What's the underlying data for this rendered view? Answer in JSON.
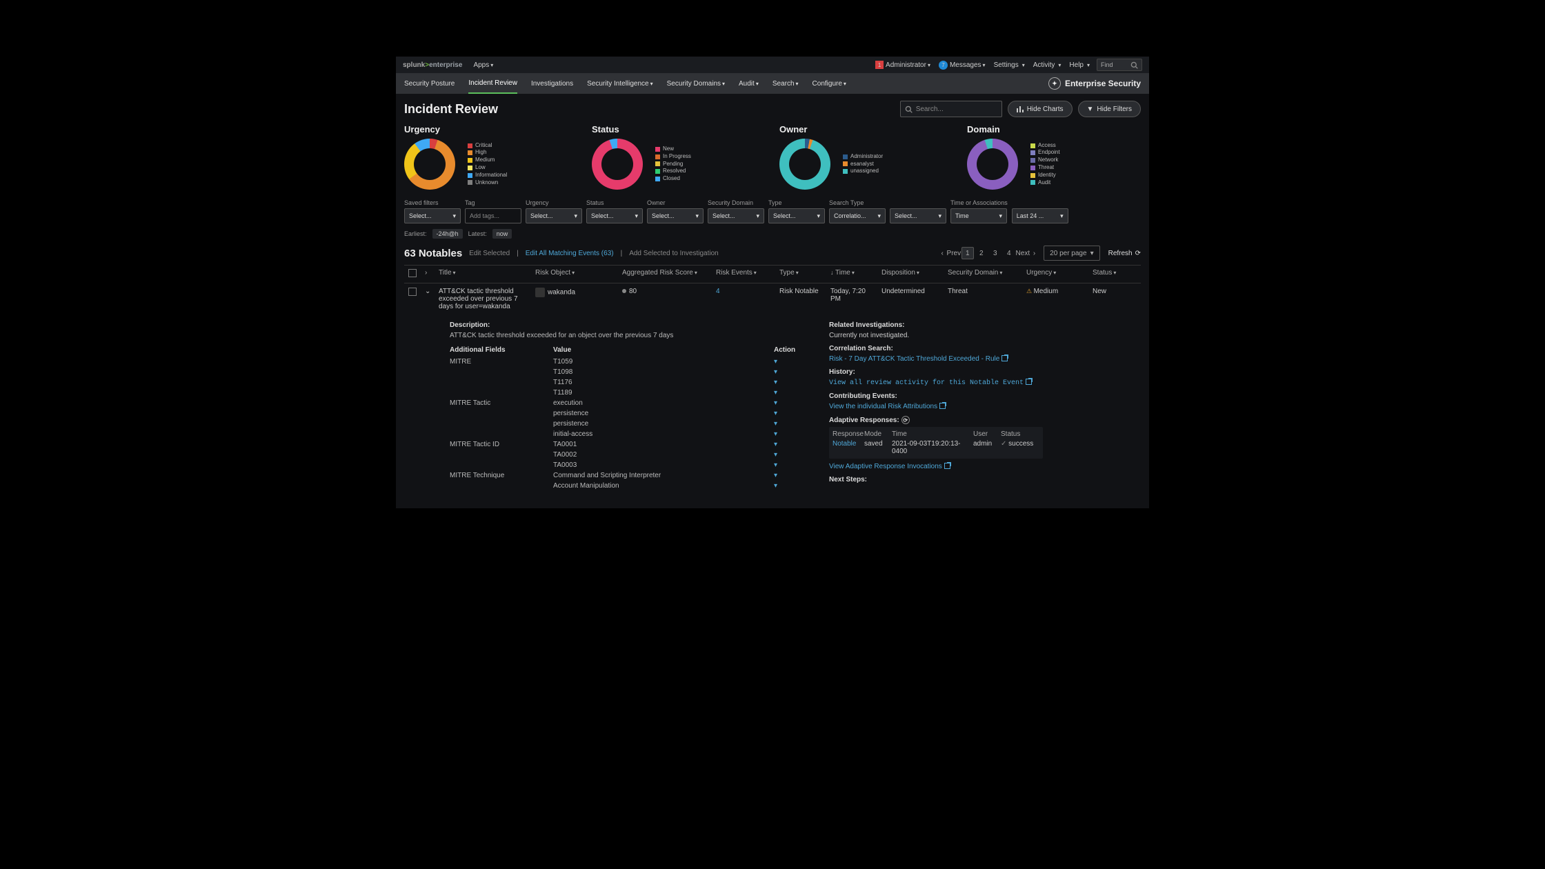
{
  "topbar": {
    "brand_pre": "splunk",
    "brand_gt": ">",
    "brand_suf": "enterprise",
    "apps": "Apps",
    "admin_badge": "1",
    "administrator": "Administrator",
    "msg_badge": "7",
    "messages": "Messages",
    "settings": "Settings",
    "activity": "Activity",
    "help": "Help",
    "find": "Find"
  },
  "nav": {
    "items": [
      "Security Posture",
      "Incident Review",
      "Investigations",
      "Security Intelligence",
      "Security Domains",
      "Audit",
      "Search",
      "Configure"
    ],
    "active": 1,
    "app_title": "Enterprise Security"
  },
  "page": {
    "title": "Incident Review",
    "search_ph": "Search...",
    "hide_charts": "Hide Charts",
    "hide_filters": "Hide Filters"
  },
  "chart_data": [
    {
      "name": "urgency",
      "title": "Urgency",
      "type": "pie",
      "series": [
        {
          "name": "Critical",
          "color": "#d93f3f",
          "value": 5
        },
        {
          "name": "High",
          "color": "#e88b2d",
          "value": 60
        },
        {
          "name": "Medium",
          "color": "#f0c419",
          "value": 25
        },
        {
          "name": "Low",
          "color": "#f5e663",
          "value": 0
        },
        {
          "name": "Informational",
          "color": "#3fa9f5",
          "value": 10
        },
        {
          "name": "Unknown",
          "color": "#7f7f7f",
          "value": 0
        }
      ]
    },
    {
      "name": "status",
      "title": "Status",
      "type": "pie",
      "series": [
        {
          "name": "New",
          "color": "#e63b6b",
          "value": 95
        },
        {
          "name": "In Progress",
          "color": "#d96b2b",
          "value": 0
        },
        {
          "name": "Pending",
          "color": "#e6c23b",
          "value": 0
        },
        {
          "name": "Resolved",
          "color": "#2ecc71",
          "value": 0
        },
        {
          "name": "Closed",
          "color": "#3fa9f5",
          "value": 5
        }
      ]
    },
    {
      "name": "owner",
      "title": "Owner",
      "type": "pie",
      "series": [
        {
          "name": "Administrator",
          "color": "#2b5b8c",
          "value": 3
        },
        {
          "name": "esanalyst",
          "color": "#e88b2d",
          "value": 2
        },
        {
          "name": "unassigned",
          "color": "#3fbfbf",
          "value": 95
        }
      ]
    },
    {
      "name": "domain",
      "title": "Domain",
      "type": "pie",
      "series": [
        {
          "name": "Access",
          "color": "#c9d94a",
          "value": 0
        },
        {
          "name": "Endpoint",
          "color": "#7f7fbf",
          "value": 0
        },
        {
          "name": "Network",
          "color": "#6a6aa6",
          "value": 0
        },
        {
          "name": "Threat",
          "color": "#8a5fbf",
          "value": 95
        },
        {
          "name": "Identity",
          "color": "#e6c23b",
          "value": 0
        },
        {
          "name": "Audit",
          "color": "#3fbfbf",
          "value": 5
        }
      ]
    }
  ],
  "filters": {
    "labels": [
      "Saved filters",
      "Tag",
      "Urgency",
      "Status",
      "Owner",
      "Security Domain",
      "Type",
      "Search Type",
      "",
      "Time or Associations",
      ""
    ],
    "values": [
      "Select...",
      "Add tags...",
      "Select...",
      "Select...",
      "Select...",
      "Select...",
      "Select...",
      "Correlatio...",
      "Select...",
      "Time",
      "Last 24 ..."
    ]
  },
  "time": {
    "earliest_lbl": "Earliest:",
    "earliest": "-24h@h",
    "latest_lbl": "Latest:",
    "latest": "now"
  },
  "list": {
    "count": "63 Notables",
    "edit_selected": "Edit Selected",
    "edit_all": "Edit All Matching Events (63)",
    "add_inv": "Add Selected to Investigation",
    "prev": "Prev",
    "next": "Next",
    "pages": [
      "1",
      "2",
      "3",
      "4"
    ],
    "per_page": "20 per page",
    "refresh": "Refresh"
  },
  "cols": {
    "title": "Title",
    "risk_obj": "Risk Object",
    "score": "Aggregated Risk Score",
    "events": "Risk Events",
    "type": "Type",
    "time": "Time",
    "disp": "Disposition",
    "dom": "Security Domain",
    "urg": "Urgency",
    "status": "Status"
  },
  "row": {
    "title": "ATT&CK tactic threshold exceeded over previous 7 days for user=wakanda",
    "risk_obj": "wakanda",
    "score": "80",
    "events": "4",
    "type": "Risk Notable",
    "time": "Today, 7:20 PM",
    "disp": "Undetermined",
    "dom": "Threat",
    "urg": "Medium",
    "status": "New"
  },
  "details": {
    "desc_h": "Description:",
    "desc": "ATT&CK tactic threshold exceeded for an object over the previous 7 days",
    "af_h": "Additional Fields",
    "val_h": "Value",
    "act_h": "Action",
    "fields": [
      {
        "l": "MITRE",
        "v": "T1059"
      },
      {
        "l": "",
        "v": "T1098"
      },
      {
        "l": "",
        "v": "T1176"
      },
      {
        "l": "",
        "v": "T1189"
      },
      {
        "l": "MITRE Tactic",
        "v": "execution"
      },
      {
        "l": "",
        "v": "persistence"
      },
      {
        "l": "",
        "v": "persistence"
      },
      {
        "l": "",
        "v": "initial-access"
      },
      {
        "l": "MITRE Tactic ID",
        "v": "TA0001"
      },
      {
        "l": "",
        "v": "TA0002"
      },
      {
        "l": "",
        "v": "TA0003"
      },
      {
        "l": "MITRE Technique",
        "v": "Command and Scripting Interpreter"
      },
      {
        "l": "",
        "v": "Account Manipulation"
      }
    ],
    "ri_h": "Related Investigations:",
    "ri_txt": "Currently not investigated.",
    "cs_h": "Correlation Search:",
    "cs_link": "Risk - 7 Day ATT&CK Tactic Threshold Exceeded - Rule",
    "hist_h": "History:",
    "hist_link": "View all review activity for this Notable Event",
    "ce_h": "Contributing Events:",
    "ce_link": "View the individual Risk Attributions",
    "ar_h": "Adaptive Responses:",
    "resp_h": {
      "r": "Response",
      "m": "Mode",
      "t": "Time",
      "u": "User",
      "s": "Status"
    },
    "resp_r": {
      "r": "Notable",
      "m": "saved",
      "t": "2021-09-03T19:20:13-0400",
      "u": "admin",
      "s": "success"
    },
    "ar_link": "View Adaptive Response Invocations",
    "ns_h": "Next Steps:"
  }
}
